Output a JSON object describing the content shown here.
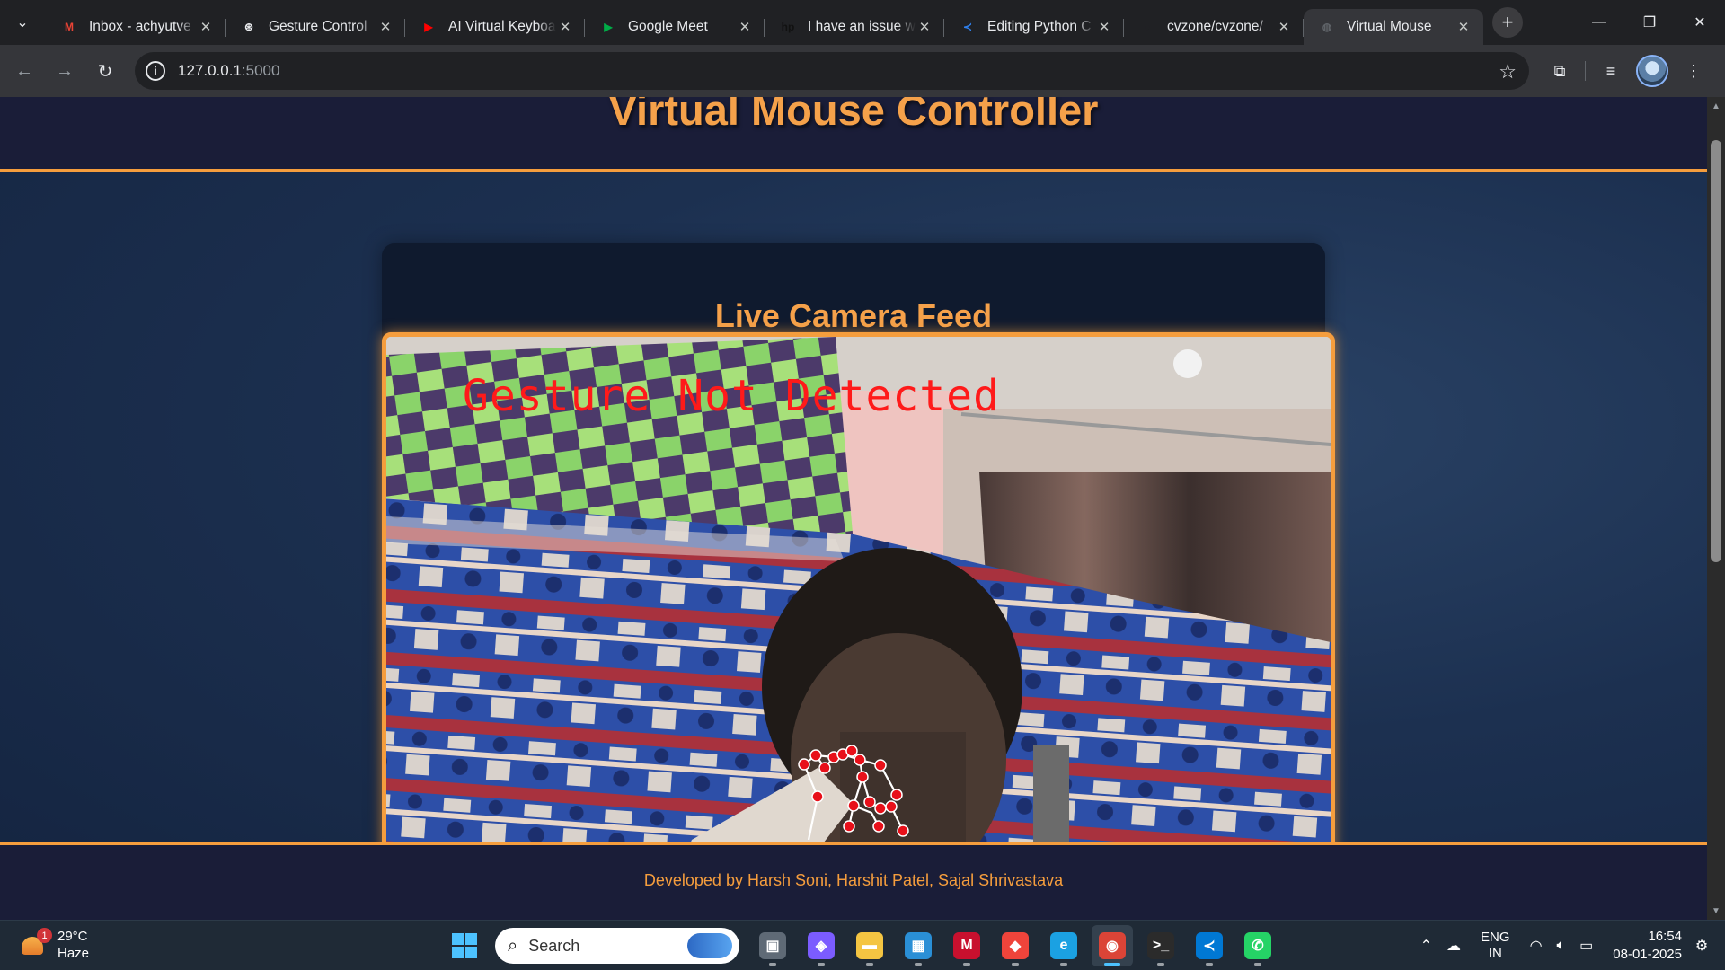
{
  "browser": {
    "tabs": [
      {
        "title": "Inbox - achyutve",
        "icon": "gmail-icon",
        "color": "#ea4335",
        "glyph": "M",
        "active": false
      },
      {
        "title": "Gesture Control",
        "icon": "chatgpt-icon",
        "color": "#e8eaed",
        "glyph": "⊛",
        "active": false
      },
      {
        "title": "AI Virtual Keyboa",
        "icon": "youtube-icon",
        "color": "#ff0000",
        "glyph": "▶",
        "active": false
      },
      {
        "title": "Google Meet",
        "icon": "google-meet-icon",
        "color": "#00ac47",
        "glyph": "▶",
        "active": false
      },
      {
        "title": "I have an issue w",
        "icon": "hp-icon",
        "color": "#111111",
        "glyph": "hp",
        "active": false
      },
      {
        "title": "Editing Python C",
        "icon": "vscode-icon",
        "color": "#2f80ed",
        "glyph": "≺",
        "active": false
      },
      {
        "title": "cvzone/cvzone/",
        "icon": "github-icon",
        "color": "#202124",
        "glyph": "●",
        "active": false
      },
      {
        "title": "Virtual Mouse",
        "icon": "globe-icon",
        "color": "#5f6368",
        "glyph": "◍",
        "active": true
      }
    ],
    "url_host": "127.0.0.1",
    "url_port": ":5000"
  },
  "page": {
    "title": "Virtual Mouse Controller",
    "feed_heading": "Live Camera Feed",
    "gesture_status": "Gesture Not Detected",
    "footer": "Developed by Harsh Soni, Harshit Patel, Sajal Shrivastava"
  },
  "taskbar": {
    "weather_temp": "29°C",
    "weather_desc": "Haze",
    "weather_badge": "1",
    "search_placeholder": "Search",
    "apps": [
      {
        "name": "task-view-icon",
        "color": "#5f6a76",
        "glyph": "▣",
        "active": false
      },
      {
        "name": "copilot-icon",
        "color": "#7b5cff",
        "glyph": "◈",
        "active": false
      },
      {
        "name": "file-explorer-icon",
        "color": "#f4c542",
        "glyph": "▬",
        "active": false
      },
      {
        "name": "microsoft-store-icon",
        "color": "#2a8fd6",
        "glyph": "▦",
        "active": false
      },
      {
        "name": "mcafee-icon",
        "color": "#c8102e",
        "glyph": "M",
        "active": false
      },
      {
        "name": "anydesk-icon",
        "color": "#ef443b",
        "glyph": "◆",
        "active": false
      },
      {
        "name": "edge-icon",
        "color": "#1ba1e2",
        "glyph": "e",
        "active": false
      },
      {
        "name": "chrome-icon",
        "color": "#db4437",
        "glyph": "◉",
        "active": true
      },
      {
        "name": "terminal-icon",
        "color": "#2b2b2b",
        "glyph": ">_",
        "active": false
      },
      {
        "name": "vscode-icon",
        "color": "#0078d4",
        "glyph": "≺",
        "active": false
      },
      {
        "name": "whatsapp-icon",
        "color": "#25d366",
        "glyph": "✆",
        "active": false
      }
    ],
    "lang_top": "ENG",
    "lang_bottom": "IN",
    "time": "16:54",
    "date": "08-01-2025"
  }
}
